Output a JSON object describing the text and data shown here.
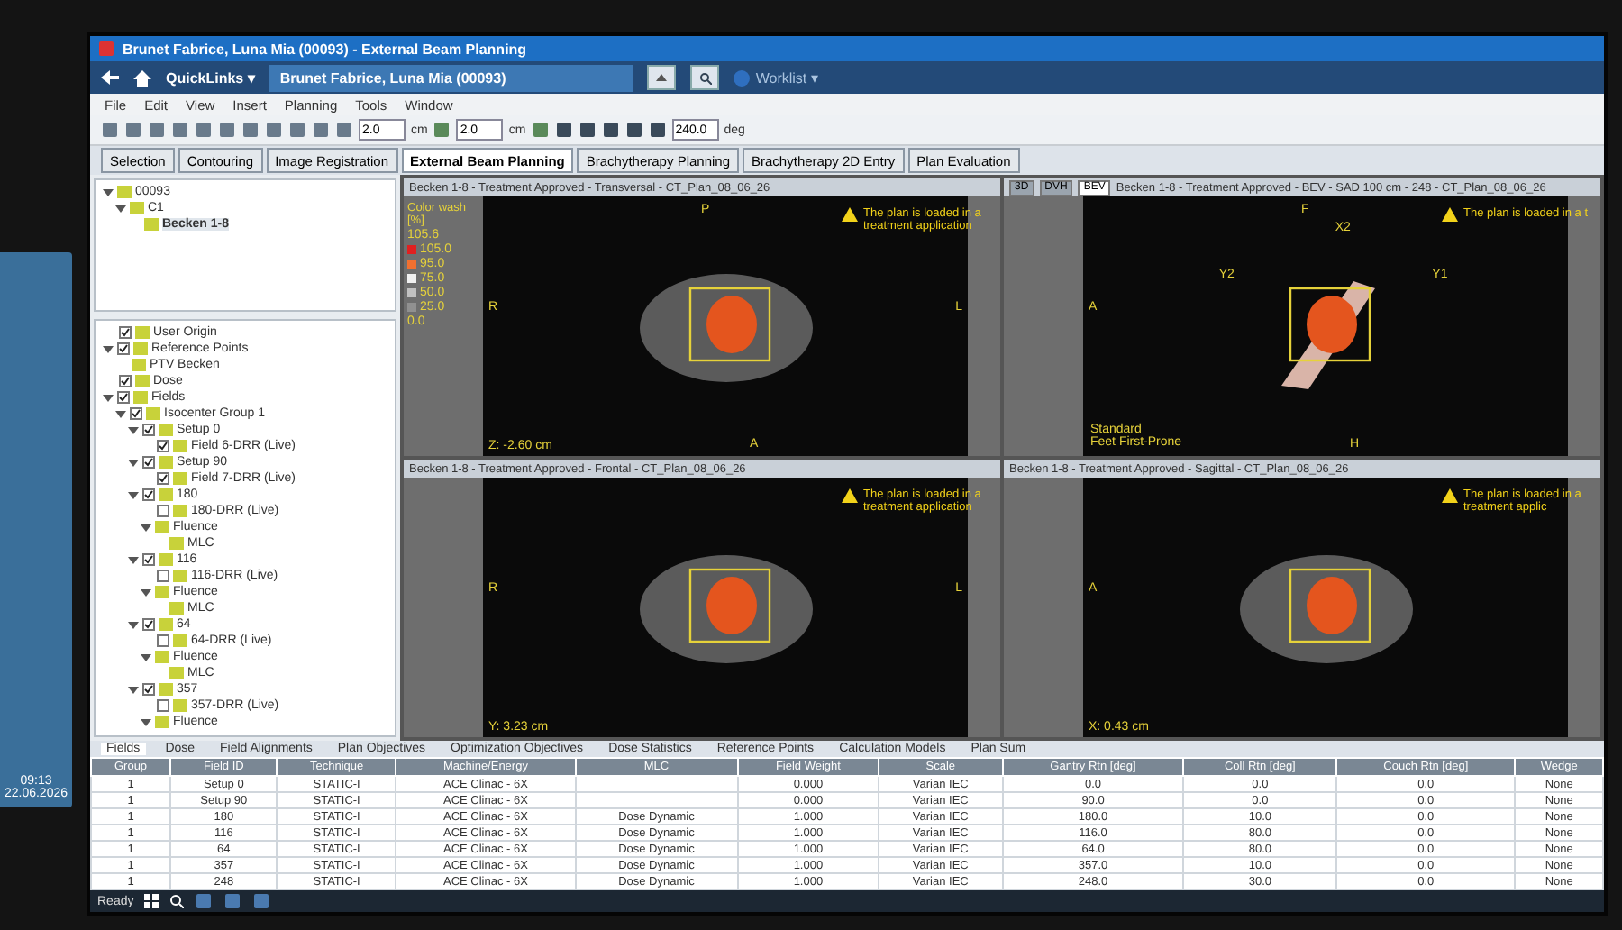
{
  "side_screen": {
    "clock": {
      "time": "09:13",
      "date": "22.06.2026"
    }
  },
  "window": {
    "title": "Brunet Fabrice, Luna Mia (00093) - External Beam Planning"
  },
  "nav": {
    "quicklinks": "QuickLinks ▾",
    "patient": "Brunet Fabrice, Luna Mia (00093)",
    "worklist": "Worklist ▾"
  },
  "menu": [
    "File",
    "Edit",
    "View",
    "Insert",
    "Planning",
    "Tools",
    "Window"
  ],
  "toolbar": {
    "fields": [
      {
        "value": "2.0",
        "unit": "cm"
      },
      {
        "value": "2.0",
        "unit": "cm"
      },
      {
        "value": "240.0",
        "unit": "deg"
      }
    ]
  },
  "workspaces": [
    {
      "label": "Selection",
      "selected": false
    },
    {
      "label": "Contouring",
      "selected": false
    },
    {
      "label": "Image Registration",
      "selected": false
    },
    {
      "label": "External Beam Planning",
      "selected": true
    },
    {
      "label": "Brachytherapy Planning",
      "selected": false
    },
    {
      "label": "Brachytherapy 2D Entry",
      "selected": false
    },
    {
      "label": "Plan Evaluation",
      "selected": false
    }
  ],
  "course_tree": [
    {
      "label": "00093",
      "expanded": true,
      "children": [
        {
          "label": "C1",
          "expanded": true,
          "children": [
            {
              "label": "Becken 1-8",
              "selected": true
            }
          ]
        }
      ]
    }
  ],
  "plan_tree": [
    {
      "label": "User Origin",
      "checked": true
    },
    {
      "label": "Reference Points",
      "checked": true,
      "expanded": true,
      "children": [
        {
          "label": "PTV Becken"
        }
      ]
    },
    {
      "label": "Dose",
      "checked": true
    },
    {
      "label": "Fields",
      "checked": true,
      "expanded": true,
      "children": [
        {
          "label": "Isocenter Group 1",
          "checked": true,
          "expanded": true,
          "children": [
            {
              "label": "Setup 0",
              "checked": true,
              "expanded": true,
              "children": [
                {
                  "label": "Field 6-DRR (Live)",
                  "checked": true
                }
              ]
            },
            {
              "label": "Setup 90",
              "checked": true,
              "expanded": true,
              "children": [
                {
                  "label": "Field 7-DRR (Live)",
                  "checked": true
                }
              ]
            },
            {
              "label": "180",
              "checked": true,
              "expanded": true,
              "children": [
                {
                  "label": "180-DRR (Live)",
                  "checked": false
                },
                {
                  "label": "Fluence",
                  "expanded": true,
                  "children": [
                    {
                      "label": "MLC"
                    }
                  ]
                }
              ]
            },
            {
              "label": "116",
              "checked": true,
              "expanded": true,
              "children": [
                {
                  "label": "116-DRR (Live)",
                  "checked": false
                },
                {
                  "label": "Fluence",
                  "expanded": true,
                  "children": [
                    {
                      "label": "MLC"
                    }
                  ]
                }
              ]
            },
            {
              "label": "64",
              "checked": true,
              "expanded": true,
              "children": [
                {
                  "label": "64-DRR (Live)",
                  "checked": false
                },
                {
                  "label": "Fluence",
                  "expanded": true,
                  "children": [
                    {
                      "label": "MLC"
                    }
                  ]
                }
              ]
            },
            {
              "label": "357",
              "checked": true,
              "expanded": true,
              "children": [
                {
                  "label": "357-DRR (Live)",
                  "checked": false
                },
                {
                  "label": "Fluence",
                  "expanded": true
                }
              ]
            }
          ]
        }
      ]
    }
  ],
  "viewers": [
    {
      "kind": "slice",
      "title": "Becken 1-8 - Treatment Approved - Transversal - CT_Plan_08_06_26",
      "legend": {
        "title": "Color wash [%]",
        "max": "105.6",
        "steps": [
          {
            "value": "105.0",
            "color": "#e02020"
          },
          {
            "value": "95.0",
            "color": "#f07030"
          },
          {
            "value": "75.0",
            "color": "#f0f0f0"
          },
          {
            "value": "50.0",
            "color": "#c0c0c0"
          },
          {
            "value": "25.0",
            "color": "#909090"
          }
        ],
        "min": "0.0"
      },
      "warning": "The plan is loaded in a treatment application",
      "orientation": {
        "top": "P",
        "bottom": "A",
        "left": "R",
        "right": "L"
      },
      "coordinate": "Z: -2.60 cm"
    },
    {
      "kind": "bev",
      "view_tabs": [
        {
          "label": "3D",
          "selected": false
        },
        {
          "label": "DVH",
          "selected": false
        },
        {
          "label": "BEV",
          "selected": true
        }
      ],
      "title": "Becken 1-8 - Treatment Approved - BEV - SAD 100 cm - 248 - CT_Plan_08_06_26",
      "warning": "The plan is loaded in a t",
      "orientation": {
        "top": "F",
        "bottom": "H",
        "left": "A"
      },
      "patient_orientation": [
        "Standard",
        "Feet First-Prone"
      ],
      "beam_labels": [
        "X2",
        "Y2",
        "Y1"
      ]
    },
    {
      "kind": "slice",
      "title": "Becken 1-8 - Treatment Approved - Frontal - CT_Plan_08_06_26",
      "warning": "The plan is loaded in a treatment application",
      "orientation": {
        "left": "R",
        "right": "L"
      },
      "coordinate": "Y: 3.23 cm"
    },
    {
      "kind": "slice",
      "title": "Becken 1-8 - Treatment Approved - Sagittal - CT_Plan_08_06_26",
      "warning": "The plan is loaded in a treatment applic",
      "orientation": {
        "left": "A"
      },
      "coordinate": "X: 0.43 cm"
    }
  ],
  "bottom_tabs": [
    {
      "label": "Fields",
      "selected": true
    },
    {
      "label": "Dose",
      "selected": false
    },
    {
      "label": "Field Alignments",
      "selected": false
    },
    {
      "label": "Plan Objectives",
      "selected": false
    },
    {
      "label": "Optimization Objectives",
      "selected": false
    },
    {
      "label": "Dose Statistics",
      "selected": false
    },
    {
      "label": "Reference Points",
      "selected": false
    },
    {
      "label": "Calculation Models",
      "selected": false
    },
    {
      "label": "Plan Sum",
      "selected": false
    }
  ],
  "table": {
    "columns": [
      "Group",
      "Field ID",
      "Technique",
      "Machine/Energy",
      "MLC",
      "Field Weight",
      "Scale",
      "Gantry Rtn [deg]",
      "Coll Rtn [deg]",
      "Couch Rtn [deg]",
      "Wedge"
    ],
    "rows": [
      [
        "1",
        "Setup 0",
        "STATIC-I",
        "ACE Clinac - 6X",
        "",
        "0.000",
        "Varian IEC",
        "0.0",
        "0.0",
        "0.0",
        "None"
      ],
      [
        "1",
        "Setup 90",
        "STATIC-I",
        "ACE Clinac - 6X",
        "",
        "0.000",
        "Varian IEC",
        "90.0",
        "0.0",
        "0.0",
        "None"
      ],
      [
        "1",
        "180",
        "STATIC-I",
        "ACE Clinac - 6X",
        "Dose Dynamic",
        "1.000",
        "Varian IEC",
        "180.0",
        "10.0",
        "0.0",
        "None"
      ],
      [
        "1",
        "116",
        "STATIC-I",
        "ACE Clinac - 6X",
        "Dose Dynamic",
        "1.000",
        "Varian IEC",
        "116.0",
        "80.0",
        "0.0",
        "None"
      ],
      [
        "1",
        "64",
        "STATIC-I",
        "ACE Clinac - 6X",
        "Dose Dynamic",
        "1.000",
        "Varian IEC",
        "64.0",
        "80.0",
        "0.0",
        "None"
      ],
      [
        "1",
        "357",
        "STATIC-I",
        "ACE Clinac - 6X",
        "Dose Dynamic",
        "1.000",
        "Varian IEC",
        "357.0",
        "10.0",
        "0.0",
        "None"
      ],
      [
        "1",
        "248",
        "STATIC-I",
        "ACE Clinac - 6X",
        "Dose Dynamic",
        "1.000",
        "Varian IEC",
        "248.0",
        "30.0",
        "0.0",
        "None"
      ]
    ]
  },
  "status_bar": {
    "text": "Ready"
  }
}
